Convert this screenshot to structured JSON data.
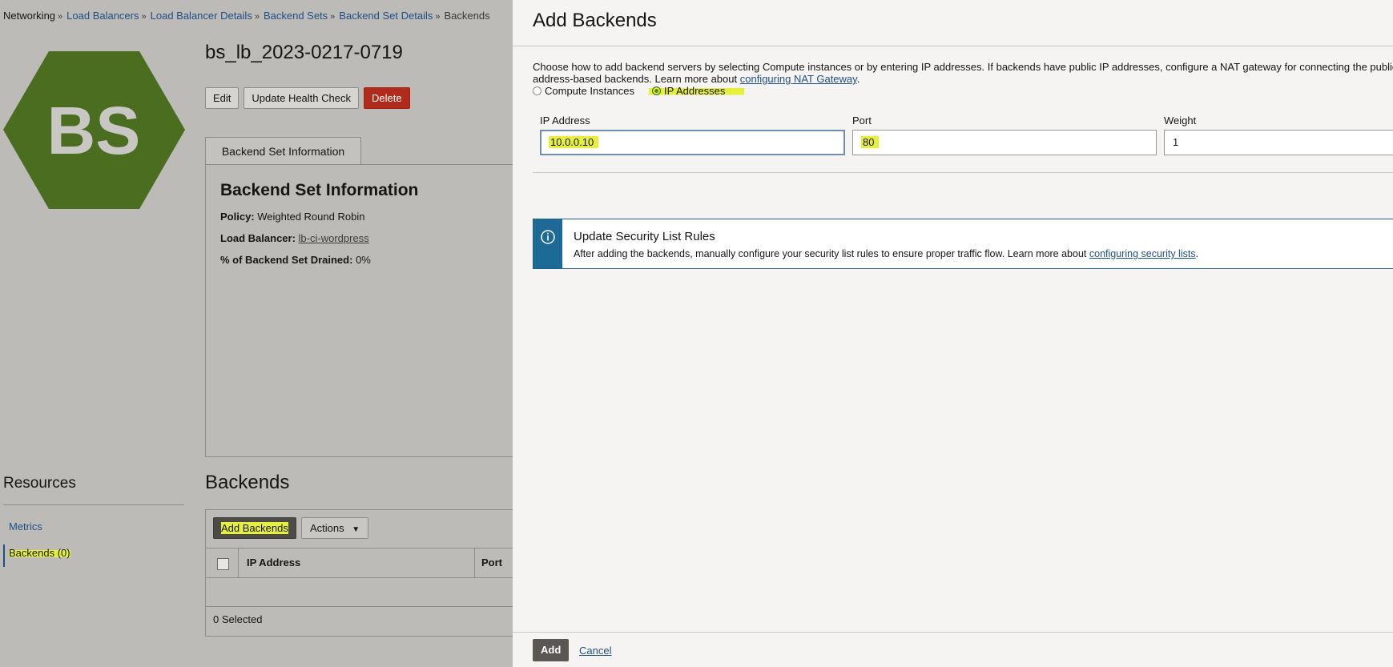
{
  "breadcrumb": {
    "items": [
      "Networking",
      "Load Balancers",
      "Load Balancer Details",
      "Backend Sets",
      "Backend Set Details",
      "Backends"
    ],
    "separator": "»"
  },
  "logo": {
    "text": "BS",
    "color": "#4a6d1f"
  },
  "page": {
    "title": "bs_lb_2023-0217-0719",
    "buttons": {
      "edit": "Edit",
      "update_health_check": "Update Health Check",
      "delete": "Delete"
    }
  },
  "info": {
    "tab": "Backend Set Information",
    "heading": "Backend Set Information",
    "policy_label": "Policy:",
    "policy_value": "Weighted Round Robin",
    "lb_label": "Load Balancer:",
    "lb_value": "lb-ci-wordpress",
    "drained_label": "% of Backend Set Drained:",
    "drained_value": "0%"
  },
  "resources": {
    "title": "Resources",
    "items": [
      "Metrics",
      "Backends (0)"
    ]
  },
  "backends": {
    "title": "Backends",
    "add_button": "Add Backends",
    "actions_button": "Actions",
    "columns": [
      "IP Address",
      "Port"
    ],
    "selected": "0 Selected"
  },
  "panel": {
    "title": "Add Backends",
    "description_line1": "Choose how to add backend servers by selecting Compute instances or by entering IP addresses. If backends have public IP addresses, configure a NAT gateway for connecting the public load",
    "description_line2": "address-based backends. Learn more about",
    "nat_link": "configuring NAT Gateway",
    "radio_compute": "Compute Instances",
    "radio_ip": "IP Addresses",
    "fields": {
      "ip_label": "IP Address",
      "ip_value": "10.0.0.10",
      "port_label": "Port",
      "port_value": "80",
      "weight_label": "Weight",
      "weight_value": "1"
    },
    "alert": {
      "title": "Update Security List Rules",
      "text": "After adding the backends, manually configure your security list rules to ensure proper traffic flow. Learn more about",
      "link": "configuring security lists"
    },
    "add_button": "Add",
    "cancel": "Cancel"
  }
}
